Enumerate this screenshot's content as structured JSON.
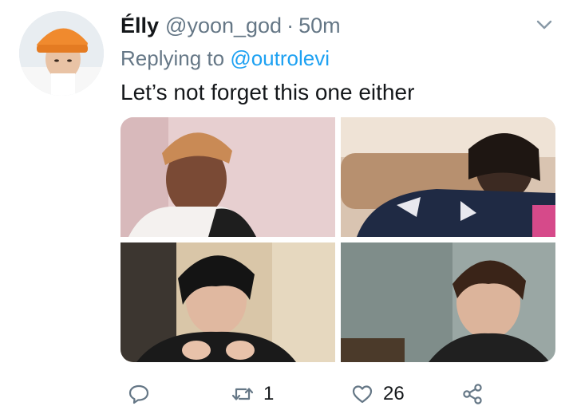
{
  "author": {
    "display_name": "Élly",
    "handle": "@yoon_god",
    "separator": "·",
    "timestamp": "50m",
    "avatar": "profile-photo-orange-beanie"
  },
  "reply": {
    "prefix": "Replying to",
    "target": "@outrolevi"
  },
  "tweet": {
    "text": "Let’s not forget this one either"
  },
  "media": {
    "images": [
      "photo-crying-woman-headscarf",
      "photo-woman-on-couch-blanket",
      "photo-man-dark-hair-gesturing",
      "photo-man-looking-sideways"
    ]
  },
  "actions": {
    "reply_count": "",
    "retweet_count": "1",
    "like_count": "26"
  },
  "icons": {
    "menu": "chevron-down-icon",
    "reply": "reply-icon",
    "retweet": "retweet-icon",
    "like": "heart-icon",
    "share": "share-icon"
  },
  "colors": {
    "text_primary": "#14171a",
    "text_secondary": "#657786",
    "link": "#1da1f2"
  }
}
